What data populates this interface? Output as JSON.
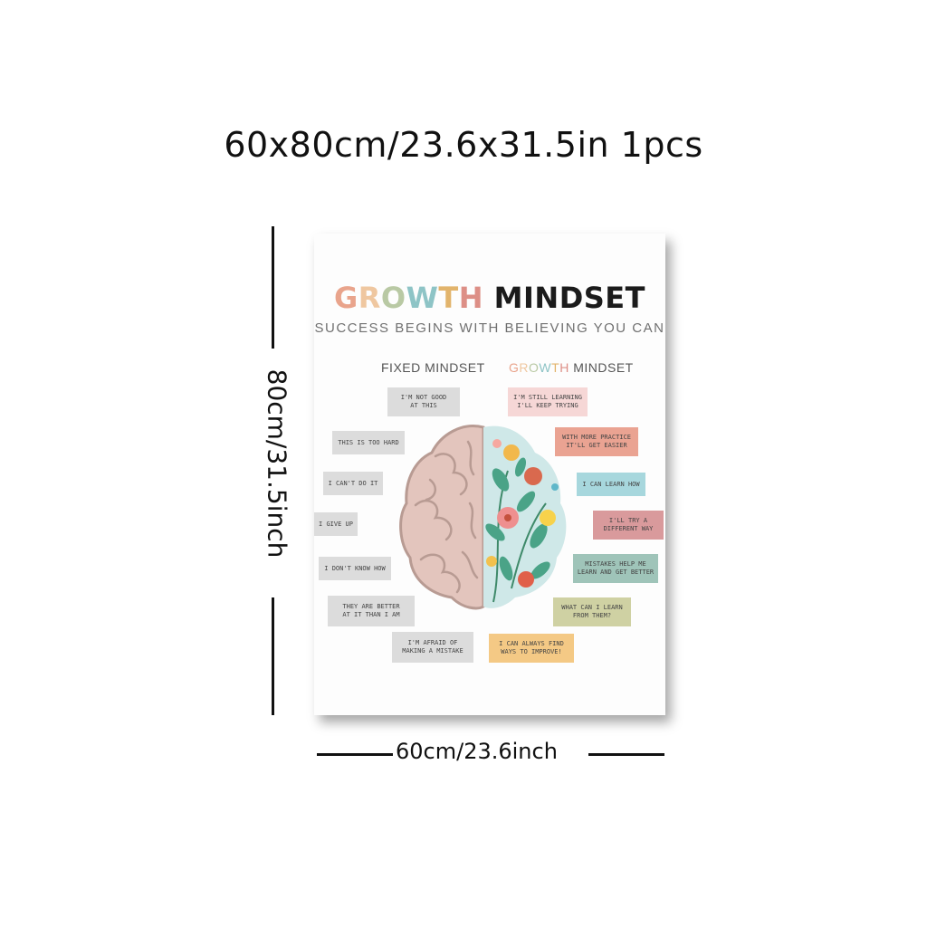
{
  "header": {
    "size_text": "60x80cm/23.6x31.5in 1pcs"
  },
  "dimensions": {
    "height_label": "80cm/31.5inch",
    "width_label": "60cm/23.6inch"
  },
  "poster": {
    "title_growth": "GROWTH",
    "title_mindset": "MINDSET",
    "title_letter_colors": [
      "#e9a48c",
      "#efc7a0",
      "#b9c9a4",
      "#8ec4c6",
      "#e2b46c",
      "#dd8f86"
    ],
    "subtitle": "SUCCESS BEGINS WITH BELIEVING YOU CAN",
    "fixed_heading": "FIXED MINDSET",
    "growth_heading_word": "GROWTH",
    "growth_heading_rest": "MINDSET",
    "fixed_statements": [
      "I'M NOT GOOD\nAT THIS",
      "THIS IS TOO HARD",
      "I CAN'T DO IT",
      "I GIVE UP",
      "I DON'T KNOW HOW",
      "THEY ARE BETTER\nAT IT THAN I AM",
      "I'M AFRAID OF\nMAKING A MISTAKE"
    ],
    "growth_statements": [
      {
        "text": "I'M STILL LEARNING\nI'LL KEEP TRYING",
        "color": "#f6d7d6"
      },
      {
        "text": "WITH MORE PRACTICE\nIT'LL GET EASIER",
        "color": "#eaa392"
      },
      {
        "text": "I CAN LEARN HOW",
        "color": "#a7d7dd"
      },
      {
        "text": "I'LL TRY A\nDIFFERENT WAY",
        "color": "#d99a9c"
      },
      {
        "text": "MISTAKES HELP ME\nLEARN AND GET BETTER",
        "color": "#9fc4b9"
      },
      {
        "text": "WHAT CAN I LEARN\nFROM THEM?",
        "color": "#cfd1a3"
      },
      {
        "text": "I CAN ALWAYS FIND\nWAYS TO IMPROVE!",
        "color": "#f4c985"
      }
    ]
  }
}
